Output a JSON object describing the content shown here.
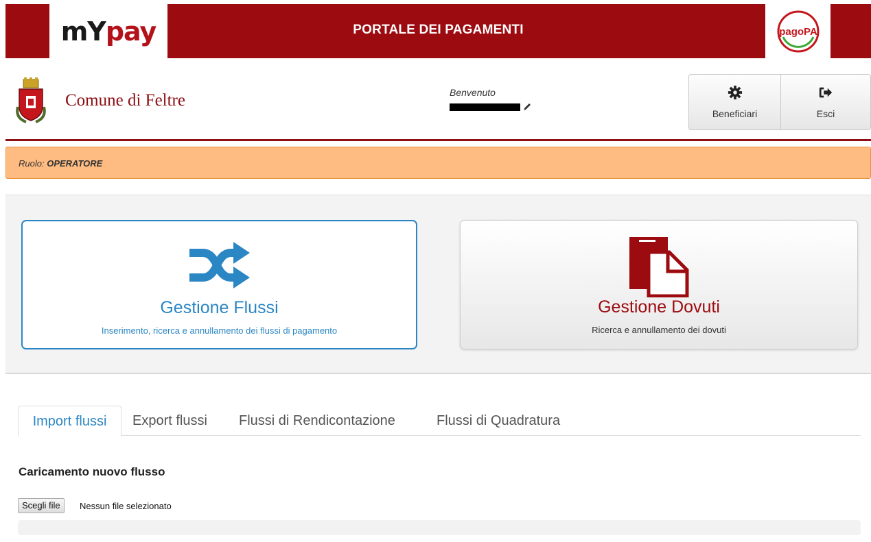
{
  "banner": {
    "logo_my": "mY",
    "logo_pay": "pay",
    "title": "PORTALE DEI PAGAMENTI",
    "pagopa_logo_text": "pagoPA"
  },
  "header": {
    "comune_name": "Comune di Feltre",
    "welcome_label": "Benvenuto",
    "buttons": {
      "beneficiari": {
        "label": "Beneficiari",
        "icon": "gear-icon"
      },
      "esci": {
        "label": "Esci",
        "icon": "sign-out-icon"
      }
    }
  },
  "role": {
    "prefix": "Ruolo: ",
    "value": "OPERATORE"
  },
  "tiles": {
    "flussi": {
      "title": "Gestione Flussi",
      "description": "Inserimento, ricerca e annullamento dei flussi di pagamento",
      "icon": "shuffle-icon"
    },
    "dovuti": {
      "title": "Gestione Dovuti",
      "description": "Ricerca e annullamento dei dovuti",
      "icon": "documents-icon"
    }
  },
  "tabs": [
    {
      "label": "Import flussi",
      "active": true
    },
    {
      "label": "Export flussi",
      "active": false
    },
    {
      "label": "Flussi di Rendicontazione",
      "active": false
    },
    {
      "label": "Flussi di Quadratura",
      "active": false
    }
  ],
  "upload": {
    "heading": "Caricamento nuovo flusso",
    "choose_button": "Scegli file",
    "status": "Nessun file selezionato",
    "progress_fraction": 0
  },
  "colors": {
    "brand_red": "#9c0b10",
    "accent_blue": "#2b86c4",
    "role_bg": "#ffbc82"
  }
}
